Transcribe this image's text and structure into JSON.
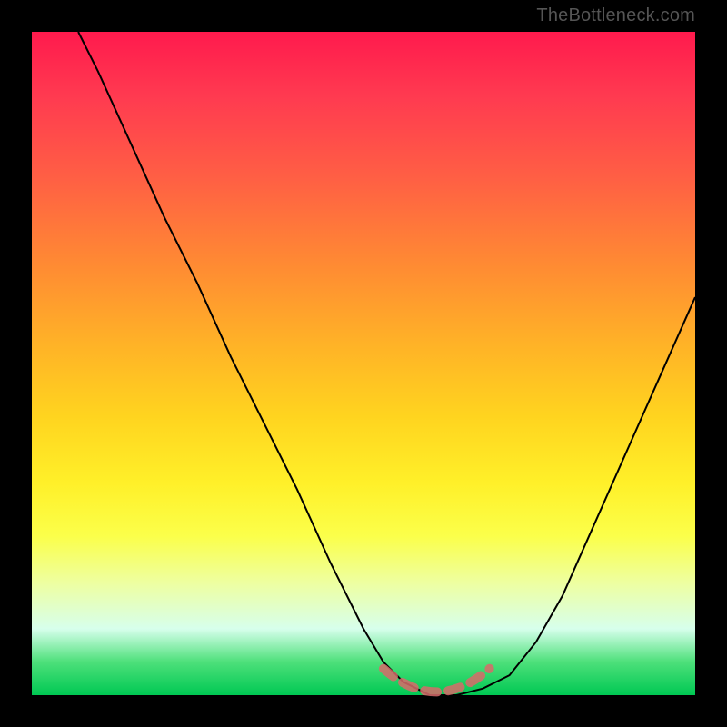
{
  "attribution": "TheBottleneck.com",
  "colors": {
    "curve": "#000000",
    "zone": "#d86a6a",
    "background_frame": "#000000"
  },
  "chart_data": {
    "type": "line",
    "title": "",
    "xlabel": "",
    "ylabel": "",
    "xlim": [
      0,
      100
    ],
    "ylim": [
      0,
      100
    ],
    "series": [
      {
        "name": "bottleneck-curve",
        "x": [
          7,
          10,
          15,
          20,
          25,
          30,
          35,
          40,
          45,
          50,
          53,
          56,
          60,
          64,
          68,
          72,
          76,
          80,
          84,
          88,
          92,
          96,
          100
        ],
        "y": [
          100,
          94,
          83,
          72,
          62,
          51,
          41,
          31,
          20,
          10,
          5,
          2,
          0,
          0,
          1,
          3,
          8,
          15,
          24,
          33,
          42,
          51,
          60
        ]
      }
    ],
    "optimal_zone": {
      "x_start": 53,
      "x_end": 69,
      "y": 1
    },
    "gradient_stops": [
      {
        "pct": 0,
        "color": "#ff1a4d"
      },
      {
        "pct": 10,
        "color": "#ff3b50"
      },
      {
        "pct": 22,
        "color": "#ff5f44"
      },
      {
        "pct": 35,
        "color": "#ff8a33"
      },
      {
        "pct": 47,
        "color": "#ffb227"
      },
      {
        "pct": 58,
        "color": "#ffd41f"
      },
      {
        "pct": 68,
        "color": "#fff029"
      },
      {
        "pct": 76,
        "color": "#fbff4a"
      },
      {
        "pct": 83,
        "color": "#eeffa0"
      },
      {
        "pct": 90,
        "color": "#d7ffec"
      },
      {
        "pct": 95,
        "color": "#4de07a"
      },
      {
        "pct": 100,
        "color": "#00c853"
      }
    ]
  }
}
